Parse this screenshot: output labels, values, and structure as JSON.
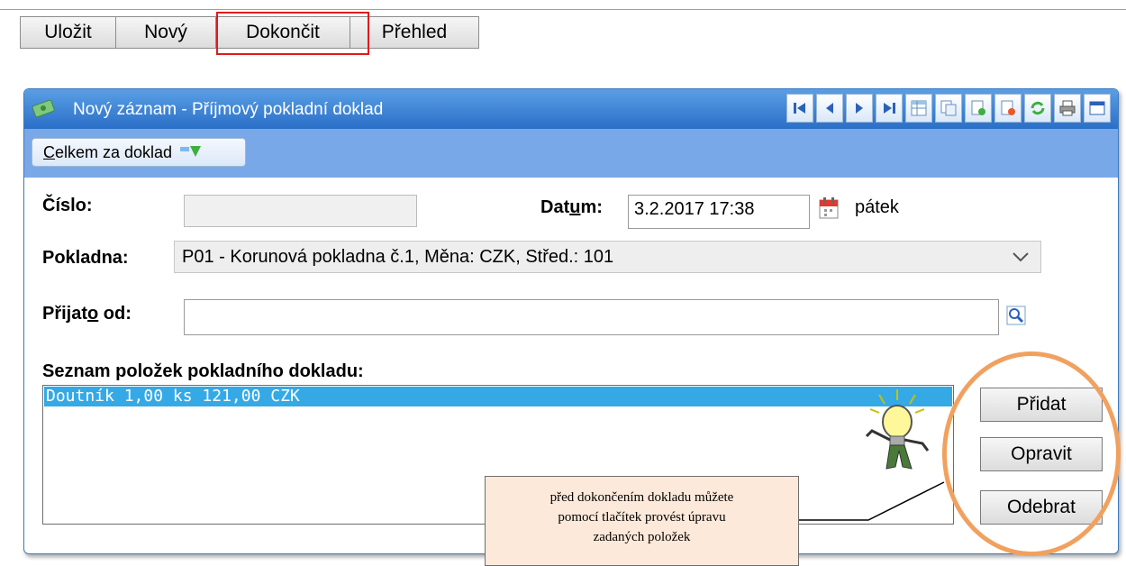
{
  "toolbar": {
    "save_label": "Uložit",
    "new_label": "Nový",
    "finish_label": "Dokončit",
    "overview_label": "Přehled"
  },
  "window": {
    "title": "Nový záznam - Příjmový pokladní doklad",
    "total_button": {
      "underlined": "C",
      "rest": "elkem za doklad"
    }
  },
  "form": {
    "number_label": "Číslo:",
    "number_value": "",
    "date_label": {
      "before": "Dat",
      "underlined": "u",
      "after": "m:"
    },
    "date_value": "3.2.2017 17:38",
    "day_name": "pátek",
    "cashbox_label": "Pokladna:",
    "cashbox_value": "P01 - Korunová pokladna č.1, Měna: CZK, Střed.: 101",
    "received_label": {
      "before": "Přijat",
      "underlined": "o",
      "after": " od:"
    },
    "received_value": ""
  },
  "items": {
    "heading": "Seznam položek pokladního dokladu:",
    "rows": [
      "Doutník 1,00 ks 121,00 CZK"
    ]
  },
  "side_buttons": {
    "add_label": "Přidat",
    "edit_label": "Opravit",
    "remove_label": "Odebrat"
  },
  "callout": {
    "lines": [
      "před dokončením dokladu můžete",
      "pomocí tlačítek provést úpravu",
      "zadaných položek"
    ]
  },
  "colors": {
    "highlight_red": "#e0191c",
    "highlight_orange": "#f1a15f",
    "titlebar_blue": "#2a6fc8",
    "selection_blue": "#35a9e6",
    "callout_bg": "#fde9d9"
  }
}
